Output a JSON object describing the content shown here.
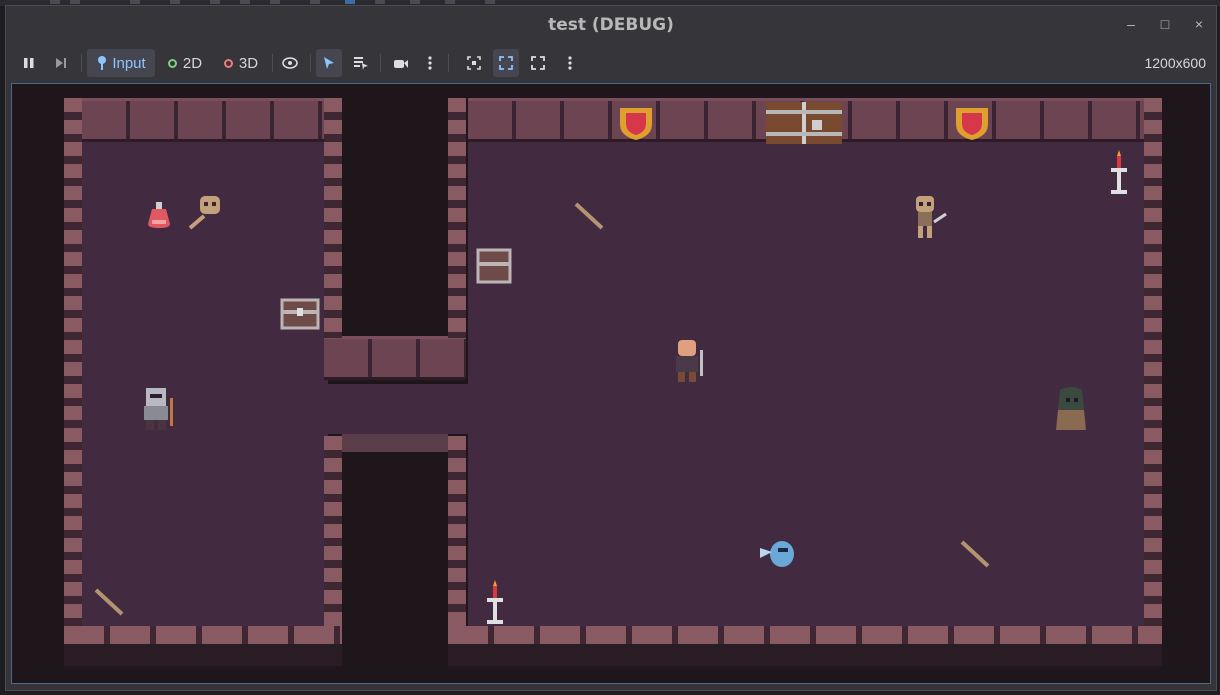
{
  "window": {
    "title": "test (DEBUG)",
    "controls": [
      "–",
      "□",
      "×"
    ]
  },
  "toolbar": {
    "input_label": "Input",
    "mode_2d_label": "2D",
    "mode_3d_label": "3D",
    "resolution": "1200x600"
  },
  "game": {
    "scene": "dungeon",
    "colors": {
      "floor": "#422a40",
      "wall": "#6d4452",
      "void": "#1f161c"
    }
  }
}
